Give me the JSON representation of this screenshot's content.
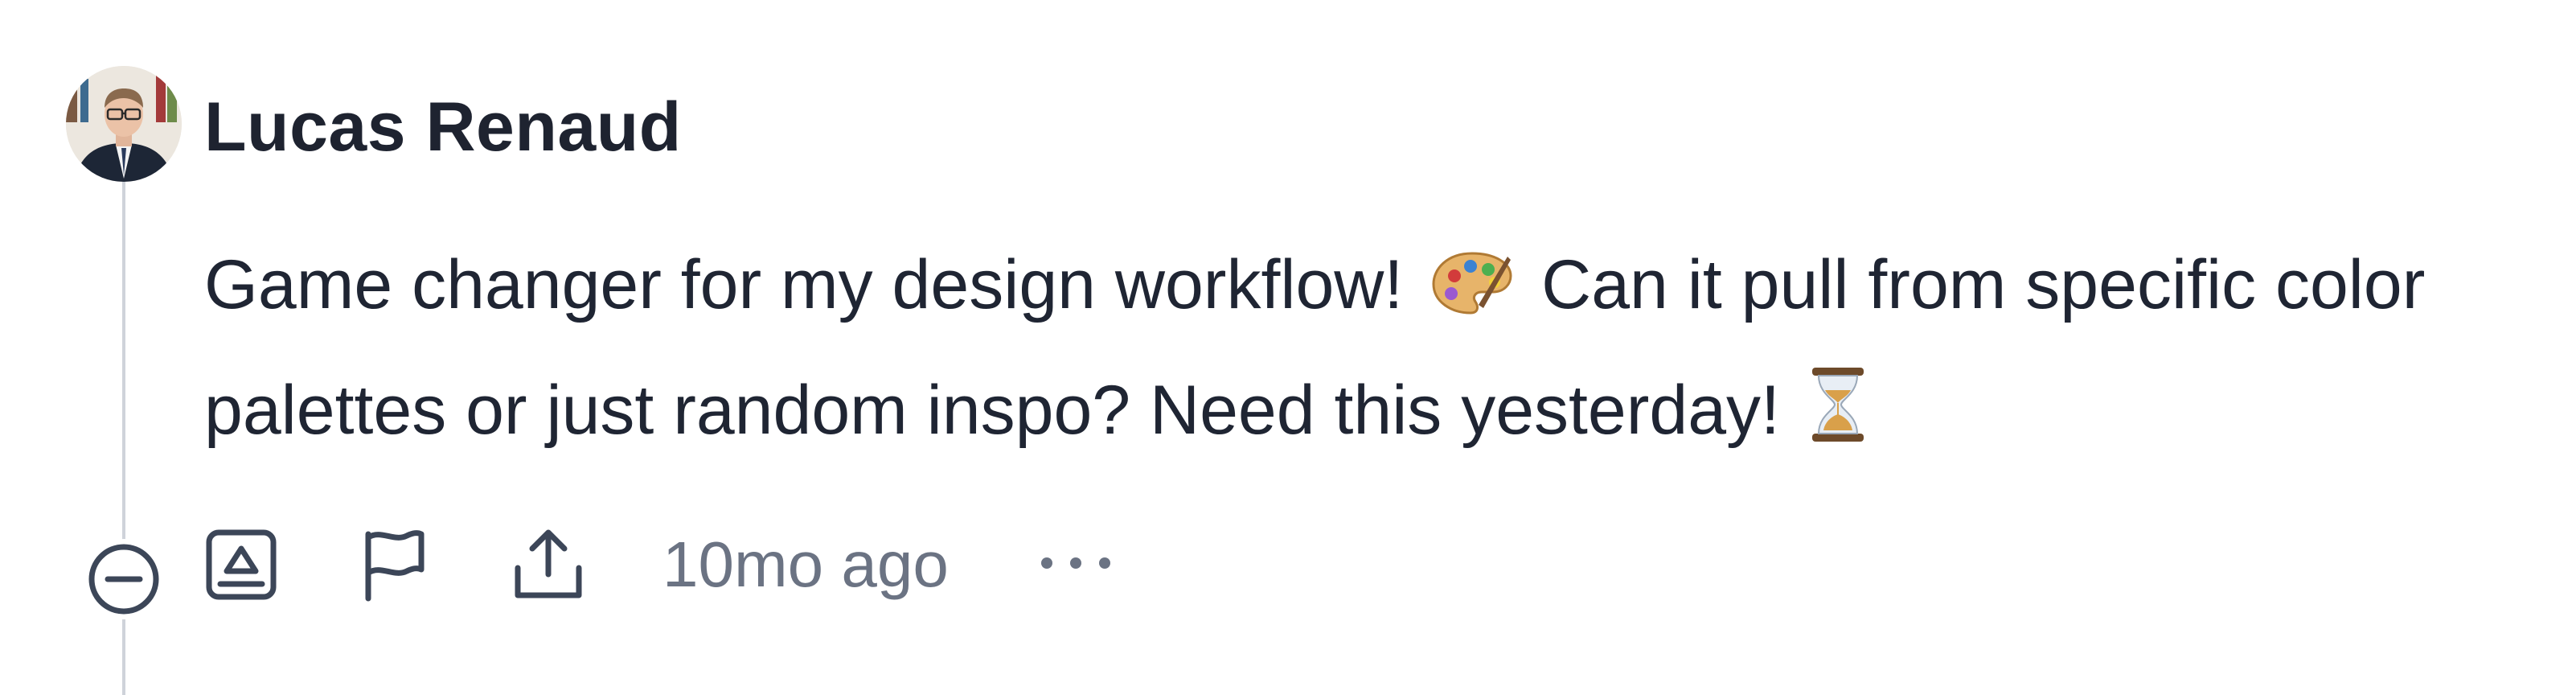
{
  "comment": {
    "author": "Lucas Renaud",
    "text_part1": "Game changer for my design workflow!",
    "emoji1": "🎨",
    "text_part2": "Can it pull from specific color palettes or just random inspo? Need this yesterday!",
    "emoji2": "⌛",
    "timestamp": "10mo ago"
  },
  "icons": {
    "avatar": "avatar-photo",
    "collapse": "minus-circle-icon",
    "upvote": "upvote-square-icon",
    "report": "flag-icon",
    "share": "share-upload-icon",
    "more": "more-horizontal-icon"
  },
  "colors": {
    "text": "#1e2330",
    "muted": "#6b7383",
    "icon": "#3c4658",
    "thread_line": "#cfd3da"
  }
}
